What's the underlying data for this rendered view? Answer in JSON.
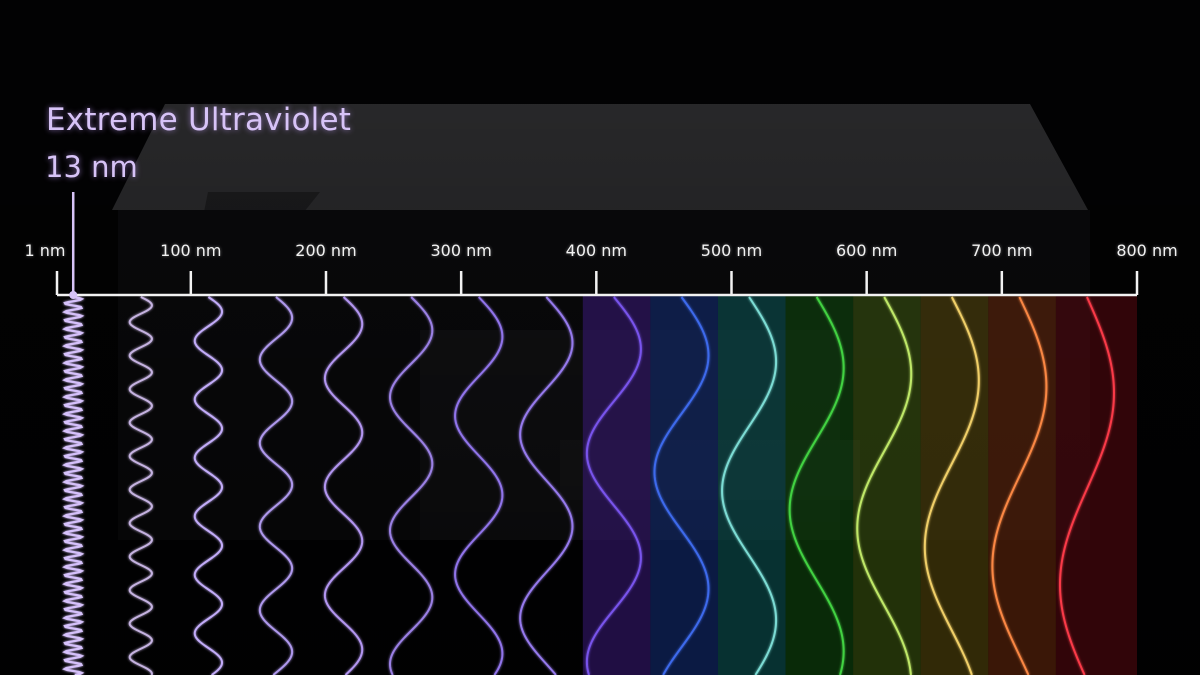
{
  "callout": {
    "title": "Extreme Ultraviolet",
    "value": "13 nm",
    "color": "#d7c3f7"
  },
  "axis": {
    "unit": "nm",
    "range_nm": [
      1,
      800
    ],
    "ticks": [
      {
        "value": 1,
        "label": "1 nm"
      },
      {
        "value": 100,
        "label": "100 nm"
      },
      {
        "value": 200,
        "label": "200 nm"
      },
      {
        "value": 300,
        "label": "300 nm"
      },
      {
        "value": 400,
        "label": "400 nm"
      },
      {
        "value": 500,
        "label": "500 nm"
      },
      {
        "value": 600,
        "label": "600 nm"
      },
      {
        "value": 700,
        "label": "700 nm"
      },
      {
        "value": 800,
        "label": "800 nm"
      }
    ],
    "marker_value": 13
  },
  "waves": [
    {
      "nm": 13,
      "color": "#d9c4ff"
    },
    {
      "nm": 63,
      "color": "#c9b6e6"
    },
    {
      "nm": 113,
      "color": "#c7b0ff"
    },
    {
      "nm": 163,
      "color": "#b39cf2"
    },
    {
      "nm": 213,
      "color": "#b79af7"
    },
    {
      "nm": 263,
      "color": "#9f84ea"
    },
    {
      "nm": 313,
      "color": "#9577f0"
    },
    {
      "nm": 363,
      "color": "#9a7df2"
    },
    {
      "nm": 413,
      "color": "#7a55f0"
    },
    {
      "nm": 463,
      "color": "#3f6cf0"
    },
    {
      "nm": 513,
      "color": "#7fe0d8"
    },
    {
      "nm": 563,
      "color": "#42d642"
    },
    {
      "nm": 613,
      "color": "#c3ec6a"
    },
    {
      "nm": 663,
      "color": "#f4d36a"
    },
    {
      "nm": 713,
      "color": "#ff8a45"
    },
    {
      "nm": 763,
      "color": "#ff3b4a"
    }
  ],
  "spectrum_bands": [
    {
      "from_nm": 390,
      "to_nm": 440,
      "color": "#3a1a7a"
    },
    {
      "from_nm": 440,
      "to_nm": 490,
      "color": "#14307a"
    },
    {
      "from_nm": 490,
      "to_nm": 540,
      "color": "#0c5a5a"
    },
    {
      "from_nm": 540,
      "to_nm": 590,
      "color": "#114d0f"
    },
    {
      "from_nm": 590,
      "to_nm": 640,
      "color": "#3e5a10"
    },
    {
      "from_nm": 640,
      "to_nm": 690,
      "color": "#5a4a0c"
    },
    {
      "from_nm": 690,
      "to_nm": 740,
      "color": "#6a2a0c"
    },
    {
      "from_nm": 740,
      "to_nm": 800,
      "color": "#5a0a10"
    }
  ]
}
